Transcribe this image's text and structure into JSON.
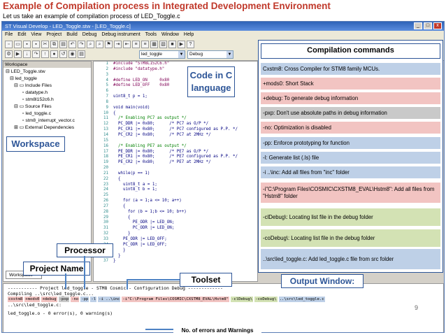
{
  "slide": {
    "title": "Example of Compilation process in Integrated Development Environment",
    "subtitle": "Let us take an example of compilation process of LED_Toggle.c",
    "page_number": "9"
  },
  "window": {
    "title": "ST Visual Develop - LED_Toggle.stw - [LED_Toggle.c]",
    "buttons": [
      "_",
      "□",
      "x"
    ]
  },
  "menu": [
    "File",
    "Edit",
    "View",
    "Project",
    "Build",
    "Debug",
    "Debug instrument",
    "Tools",
    "Window",
    "Help"
  ],
  "toolbar": {
    "project_combo": "led_toggle",
    "config_combo": "Debug"
  },
  "workspace": {
    "header": "Workspace",
    "tab_label": "Workspace",
    "tree": [
      {
        "label": "LED_Toggle.stw",
        "level": 0
      },
      {
        "label": "led_toggle",
        "level": 1
      },
      {
        "label": "Include Files",
        "level": 2
      },
      {
        "label": "datatype.h",
        "level": 3
      },
      {
        "label": "stm8l152c6.h",
        "level": 3
      },
      {
        "label": "Source Files",
        "level": 2
      },
      {
        "label": "led_toggle.c",
        "level": 3
      },
      {
        "label": "stm8_interrupt_vector.c",
        "level": 3
      },
      {
        "label": "External Dependencies",
        "level": 2
      }
    ]
  },
  "code": {
    "lines": [
      {
        "num": "1",
        "text": "#include \"STM8L152C6.h\"",
        "kind": "pp"
      },
      {
        "num": "2",
        "text": "#include \"datatype.h\"",
        "kind": "pp"
      },
      {
        "num": "3",
        "text": "",
        "kind": "code"
      },
      {
        "num": "4",
        "text": "#define LED_ON     0x80",
        "kind": "pp"
      },
      {
        "num": "5",
        "text": "#define LED_OFF    0x80",
        "kind": "pp"
      },
      {
        "num": "6",
        "text": "",
        "kind": "code"
      },
      {
        "num": "7",
        "text": "uint8_t p = 1;",
        "kind": "code"
      },
      {
        "num": "8",
        "text": "",
        "kind": "code"
      },
      {
        "num": "9",
        "text": "void main(void)",
        "kind": "code"
      },
      {
        "num": "10",
        "text": "{",
        "kind": "code"
      },
      {
        "num": "11",
        "text": "  /* Enabling PC7 as output */",
        "kind": "cm"
      },
      {
        "num": "12",
        "text": "  PC_DDR |= 0x80;      /* PC7 as O/P */",
        "kind": "code"
      },
      {
        "num": "13",
        "text": "  PC_CR1 |= 0x80;      /* PC7 configured as P.P. */",
        "kind": "code"
      },
      {
        "num": "14",
        "text": "  PC_CR2 |= 0x80;      /* PC7 at 2MHz */",
        "kind": "code"
      },
      {
        "num": "15",
        "text": "",
        "kind": "code"
      },
      {
        "num": "16",
        "text": "  /* Enabling PE7 as output */",
        "kind": "cm"
      },
      {
        "num": "17",
        "text": "  PE_DDR |= 0x80;      /* PE7 as O/P */",
        "kind": "code"
      },
      {
        "num": "18",
        "text": "  PE_CR1 |= 0x80;      /* PE7 configured as P.P. */",
        "kind": "code"
      },
      {
        "num": "19",
        "text": "  PE_CR2 |= 0x80;      /* PE7 at 2MHz */",
        "kind": "code"
      },
      {
        "num": "20",
        "text": "",
        "kind": "code"
      },
      {
        "num": "21",
        "text": "  while(p == 1)",
        "kind": "code"
      },
      {
        "num": "22",
        "text": "  {",
        "kind": "code"
      },
      {
        "num": "23",
        "text": "    uint8_t a = 1;",
        "kind": "code"
      },
      {
        "num": "24",
        "text": "    uint8_t b = 1;",
        "kind": "code"
      },
      {
        "num": "25",
        "text": "",
        "kind": "code"
      },
      {
        "num": "26",
        "text": "    for (a = 1;a <= 10; a++)",
        "kind": "code"
      },
      {
        "num": "27",
        "text": "    {",
        "kind": "code"
      },
      {
        "num": "28",
        "text": "      for (b = 1;b <= 10; b++)",
        "kind": "code"
      },
      {
        "num": "29",
        "text": "      {",
        "kind": "code"
      },
      {
        "num": "30",
        "text": "        PE_ODR |= LED_ON;",
        "kind": "code"
      },
      {
        "num": "31",
        "text": "        PC_ODR |= LED_ON;",
        "kind": "code"
      },
      {
        "num": "32",
        "text": "      }",
        "kind": "code"
      },
      {
        "num": "33",
        "text": "    PE_ODR |= LED_OFF;",
        "kind": "code"
      },
      {
        "num": "34",
        "text": "    PC_ODR |= LED_OFF;",
        "kind": "code"
      },
      {
        "num": "35",
        "text": "    }",
        "kind": "code"
      },
      {
        "num": "36",
        "text": "  }",
        "kind": "code"
      },
      {
        "num": "37",
        "text": "}",
        "kind": "code"
      }
    ]
  },
  "output": {
    "line1": "----------- Project led_toggle - STM8 Cosmic - Configuration Debug -------------",
    "line2": "Compiling ..\\src\\led_toggle.c...",
    "command_segments": [
      {
        "text": "cxstm8",
        "color": "#f2c4c2"
      },
      {
        "text": "+mods0",
        "color": "#f2c4c2"
      },
      {
        "text": "+debug",
        "color": "#f2c4c2"
      },
      {
        "text": "-pxp",
        "color": "#c9c9c9"
      },
      {
        "text": "-no",
        "color": "#f2c4c2"
      },
      {
        "text": "-pp",
        "color": "#bed0e7"
      },
      {
        "text": "-l",
        "color": "#bed0e7"
      },
      {
        "text": "-i ..\\inc",
        "color": "#bed0e7"
      },
      {
        "text": "-i\"C:\\Program Files\\COSMIC\\CXSTM8_EVAL\\Hstm8\"",
        "color": "#f2c4c2"
      },
      {
        "text": "-clDebug\\",
        "color": "#d3e2b4"
      },
      {
        "text": "-coDebug\\",
        "color": "#d3e2b4"
      },
      {
        "text": "..\\src\\led_toggle.c",
        "color": "#bed0e7"
      }
    ],
    "line4": "..\\src\\led_toggle.c:",
    "line5": "led_toggle.o - 0 error(s), 0 warning(s)"
  },
  "callouts": {
    "code_in_c": "Code in C language",
    "workspace": "Workspace",
    "processor": "Processor",
    "project_name": "Project Name",
    "toolset": "Toolset",
    "output_window": "Output Window:",
    "errors": "No. of errors and Warnings"
  },
  "compilation_commands": {
    "title": "Compilation commands",
    "items": [
      {
        "text": "Cxstm8: Cross Compiler for  STM8  family MCUs.",
        "style": "blue"
      },
      {
        "text": "+mods0: Short Stack",
        "style": "pink"
      },
      {
        "text": "+debug: To generate debug information",
        "style": "pink"
      },
      {
        "text": "-pxp: Don't use absolute paths in debug information",
        "style": "grey"
      },
      {
        "text": "-no: Optimization is disabled",
        "style": "pink"
      },
      {
        "text": "-pp: Enforce prototyping for function",
        "style": "blue"
      },
      {
        "text": "-l: Generate list (.ls) file",
        "style": "blue"
      },
      {
        "text": "-i ..\\inc: Add all files from \"inc\" folder",
        "style": "blue"
      },
      {
        "text": "-i\"C:\\Program Files\\COSMIC\\CXSTM8_EVAL\\Hstm8\": Add all files from \"Hstm8\" folder",
        "style": "pink"
      },
      {
        "text": "-clDebug\\: Locating list file in the debug folder",
        "style": "green"
      },
      {
        "text": "-coDebug\\: Locating list file in the debug folder",
        "style": "green"
      },
      {
        "text": "..\\src\\led_toggle.c: Add led_toggle.c file from src folder",
        "style": "blue"
      }
    ]
  },
  "colors": {
    "title_red": "#c0392b",
    "callout_blue": "#4d82c4",
    "pink": "#f2c4c2",
    "green": "#d3e2b4",
    "blue": "#bed0e7",
    "grey": "#c9c9c9"
  }
}
